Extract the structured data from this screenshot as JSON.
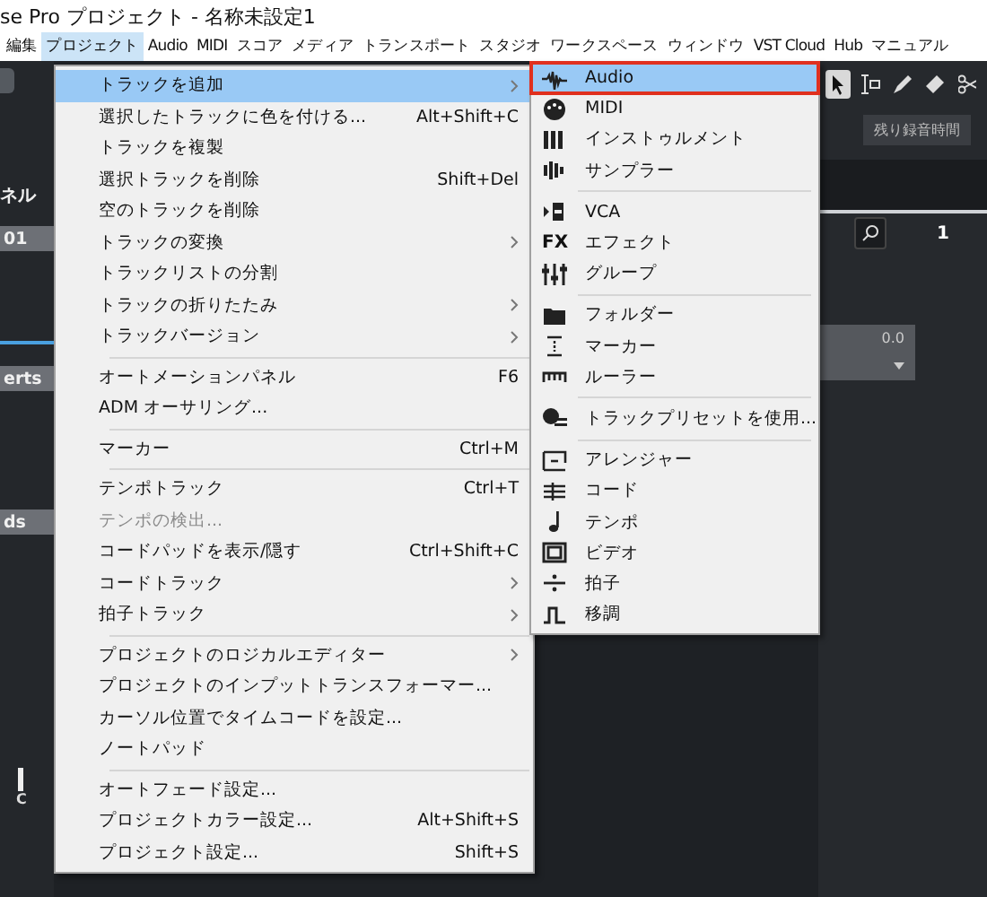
{
  "window": {
    "title": "se Pro プロジェクト - 名称未設定1"
  },
  "menu_bar": [
    {
      "label": "編集",
      "selected": false
    },
    {
      "label": "プロジェクト",
      "selected": true
    },
    {
      "label": "Audio",
      "selected": false
    },
    {
      "label": "MIDI",
      "selected": false
    },
    {
      "label": "スコア",
      "selected": false
    },
    {
      "label": "メディア",
      "selected": false
    },
    {
      "label": "トランスポート",
      "selected": false
    },
    {
      "label": "スタジオ",
      "selected": false
    },
    {
      "label": "ワークスペース",
      "selected": false
    },
    {
      "label": "ウィンドウ",
      "selected": false
    },
    {
      "label": "VST Cloud",
      "selected": false
    },
    {
      "label": "Hub",
      "selected": false
    },
    {
      "label": "マニュアル",
      "selected": false
    }
  ],
  "left_panel": {
    "title": "ネル",
    "track_number": "01",
    "inserts_tab": "erts",
    "sends_tab": "ds",
    "pan_label": "C"
  },
  "right_panel": {
    "record_time_label": "残り録音時間",
    "value": "0.0",
    "ruler_marker": "1"
  },
  "project_menu": {
    "groups": [
      [
        {
          "label": "トラックを追加",
          "submenu": true,
          "selected": true,
          "disabled": false
        },
        {
          "label": "選択したトラックに色を付ける...",
          "shortcut": "Alt+Shift+C",
          "submenu": false,
          "selected": false,
          "disabled": false
        },
        {
          "label": "トラックを複製",
          "submenu": false,
          "selected": false,
          "disabled": false
        },
        {
          "label": "選択トラックを削除",
          "shortcut": "Shift+Del",
          "submenu": false,
          "selected": false,
          "disabled": false
        },
        {
          "label": "空のトラックを削除",
          "submenu": false,
          "selected": false,
          "disabled": false
        },
        {
          "label": "トラックの変換",
          "submenu": true,
          "selected": false,
          "disabled": false
        },
        {
          "label": "トラックリストの分割",
          "submenu": false,
          "selected": false,
          "disabled": false
        },
        {
          "label": "トラックの折りたたみ",
          "submenu": true,
          "selected": false,
          "disabled": false
        },
        {
          "label": "トラックバージョン",
          "submenu": true,
          "selected": false,
          "disabled": false
        }
      ],
      [
        {
          "label": "オートメーションパネル",
          "shortcut": "F6",
          "submenu": false,
          "selected": false,
          "disabled": false
        },
        {
          "label": "ADM オーサリング...",
          "submenu": false,
          "selected": false,
          "disabled": false
        }
      ],
      [
        {
          "label": "マーカー",
          "shortcut": "Ctrl+M",
          "submenu": false,
          "selected": false,
          "disabled": false
        }
      ],
      [
        {
          "label": "テンポトラック",
          "shortcut": "Ctrl+T",
          "submenu": false,
          "selected": false,
          "disabled": false
        },
        {
          "label": "テンポの検出...",
          "submenu": false,
          "selected": false,
          "disabled": true
        },
        {
          "label": "コードパッドを表示/隠す",
          "shortcut": "Ctrl+Shift+C",
          "submenu": false,
          "selected": false,
          "disabled": false
        },
        {
          "label": "コードトラック",
          "submenu": true,
          "selected": false,
          "disabled": false
        },
        {
          "label": "拍子トラック",
          "submenu": true,
          "selected": false,
          "disabled": false
        }
      ],
      [
        {
          "label": "プロジェクトのロジカルエディター",
          "submenu": true,
          "selected": false,
          "disabled": false
        },
        {
          "label": "プロジェクトのインプットトランスフォーマー...",
          "submenu": false,
          "selected": false,
          "disabled": false
        },
        {
          "label": "カーソル位置でタイムコードを設定...",
          "submenu": false,
          "selected": false,
          "disabled": false
        },
        {
          "label": "ノートパッド",
          "submenu": false,
          "selected": false,
          "disabled": false
        }
      ],
      [
        {
          "label": "オートフェード設定...",
          "submenu": false,
          "selected": false,
          "disabled": false
        },
        {
          "label": "プロジェクトカラー設定...",
          "shortcut": "Alt+Shift+S",
          "submenu": false,
          "selected": false,
          "disabled": false
        },
        {
          "label": "プロジェクト設定...",
          "shortcut": "Shift+S",
          "submenu": false,
          "selected": false,
          "disabled": false
        }
      ]
    ]
  },
  "add_track_submenu": {
    "groups": [
      [
        {
          "label": "Audio",
          "kind": "waveform",
          "selected": true,
          "outlined": true
        },
        {
          "label": "MIDI",
          "kind": "midi",
          "selected": false,
          "outlined": false
        },
        {
          "label": "インストゥルメント",
          "kind": "piano",
          "selected": false,
          "outlined": false
        },
        {
          "label": "サンプラー",
          "kind": "sampler",
          "selected": false,
          "outlined": false
        }
      ],
      [
        {
          "label": "VCA",
          "kind": "vca",
          "selected": false,
          "outlined": false
        },
        {
          "label": "エフェクト",
          "kind": "text",
          "icon_text": "FX",
          "selected": false,
          "outlined": false
        },
        {
          "label": "グループ",
          "kind": "faders",
          "selected": false,
          "outlined": false
        }
      ],
      [
        {
          "label": "フォルダー",
          "kind": "folder",
          "selected": false,
          "outlined": false
        },
        {
          "label": "マーカー",
          "kind": "marker",
          "selected": false,
          "outlined": false
        },
        {
          "label": "ルーラー",
          "kind": "ruler",
          "selected": false,
          "outlined": false
        }
      ],
      [
        {
          "label": "トラックプリセットを使用...",
          "kind": "preset",
          "selected": false,
          "outlined": false
        }
      ],
      [
        {
          "label": "アレンジャー",
          "kind": "arranger",
          "selected": false,
          "outlined": false
        },
        {
          "label": "コード",
          "kind": "chord",
          "selected": false,
          "outlined": false
        },
        {
          "label": "テンポ",
          "kind": "note",
          "selected": false,
          "outlined": false
        },
        {
          "label": "ビデオ",
          "kind": "film",
          "selected": false,
          "outlined": false
        },
        {
          "label": "拍子",
          "kind": "divide",
          "selected": false,
          "outlined": false
        },
        {
          "label": "移調",
          "kind": "step",
          "selected": false,
          "outlined": false
        }
      ]
    ]
  }
}
